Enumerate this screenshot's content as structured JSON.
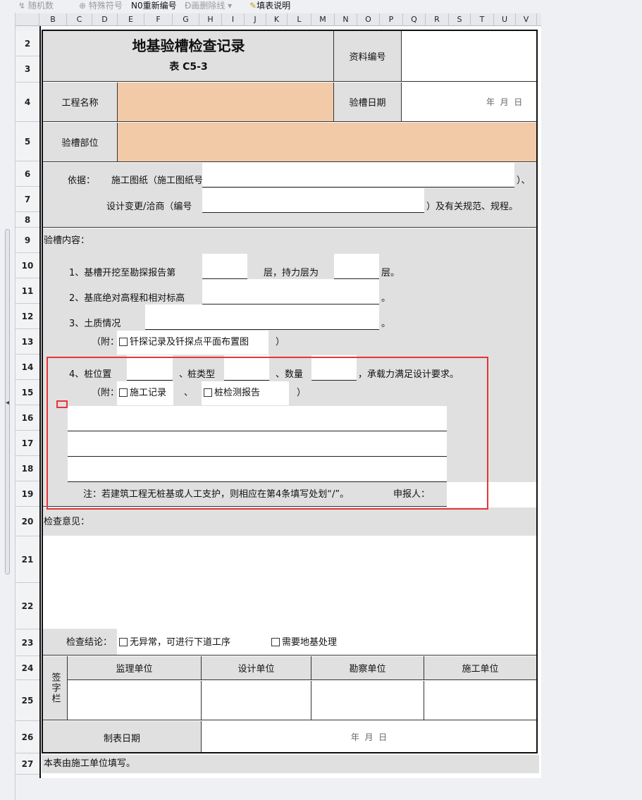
{
  "toolbar": {
    "random": "随机数",
    "special": "特殊符号",
    "renumber_prefix": "N0",
    "renumber": "重新编号",
    "strike": "画删除线",
    "fill_help": "填表说明"
  },
  "columns": [
    "B",
    "C",
    "D",
    "E",
    "F",
    "G",
    "H",
    "I",
    "J",
    "K",
    "L",
    "M",
    "N",
    "O",
    "P",
    "Q",
    "R",
    "S",
    "T",
    "U",
    "V"
  ],
  "rows": [
    "2",
    "3",
    "4",
    "5",
    "6",
    "7",
    "8",
    "9",
    "10",
    "11",
    "12",
    "13",
    "14",
    "15",
    "16",
    "17",
    "18",
    "19",
    "20",
    "21",
    "22",
    "23",
    "24",
    "25",
    "26",
    "27"
  ],
  "form": {
    "title": "地基验槽检查记录",
    "subtitle": "表 C5-3",
    "doc_no_label": "资料编号",
    "project_label": "工程名称",
    "check_date_label": "验槽日期",
    "date_ymd": "年  月  日",
    "part_label": "验槽部位",
    "basis_prefix": "依据：",
    "basis_drawings": "施工图纸（施工图纸号",
    "basis_end": "）、",
    "design_change": "设计变更/洽商（编号",
    "design_change_end": "）及有关规范、规程。",
    "content_label": "验槽内容：",
    "item1_a": "1、基槽开挖至勘探报告第",
    "item1_b": "层，持力层为",
    "item1_c": "层。",
    "item2": "2、基底绝对高程和相对标高",
    "item_period": "。",
    "item3": "3、土质情况",
    "attach_open": "（附：",
    "attach1": "钎探记录及钎探点平面布置图",
    "attach_close": "）",
    "item4_a": "4、桩位置",
    "item4_sep": "、",
    "item4_b": "桩类型",
    "item4_c": "数量",
    "item4_d": "，承载力满足设计要求。",
    "attach2_a": "施工记录",
    "attach2_b": "桩检测报告",
    "note": "注：若建筑工程无桩基或人工支护，则相应在第4条填写处划“/”。",
    "applicant": "申报人：",
    "opinion_label": "检查意见：",
    "conclusion_label": "检查结论：",
    "conclusion_opt1": "无异常，可进行下道工序",
    "conclusion_opt2": "需要地基处理",
    "sign_label": "签字栏",
    "sign_cols": [
      "监理单位",
      "设计单位",
      "勘察单位",
      "施工单位"
    ],
    "made_date_label": "制表日期",
    "footer": "本表由施工单位填写。"
  },
  "colors": {
    "accent_orange": "#f2caa8",
    "gray_cell": "#e0e0e0",
    "selection_red": "#e8343a"
  }
}
